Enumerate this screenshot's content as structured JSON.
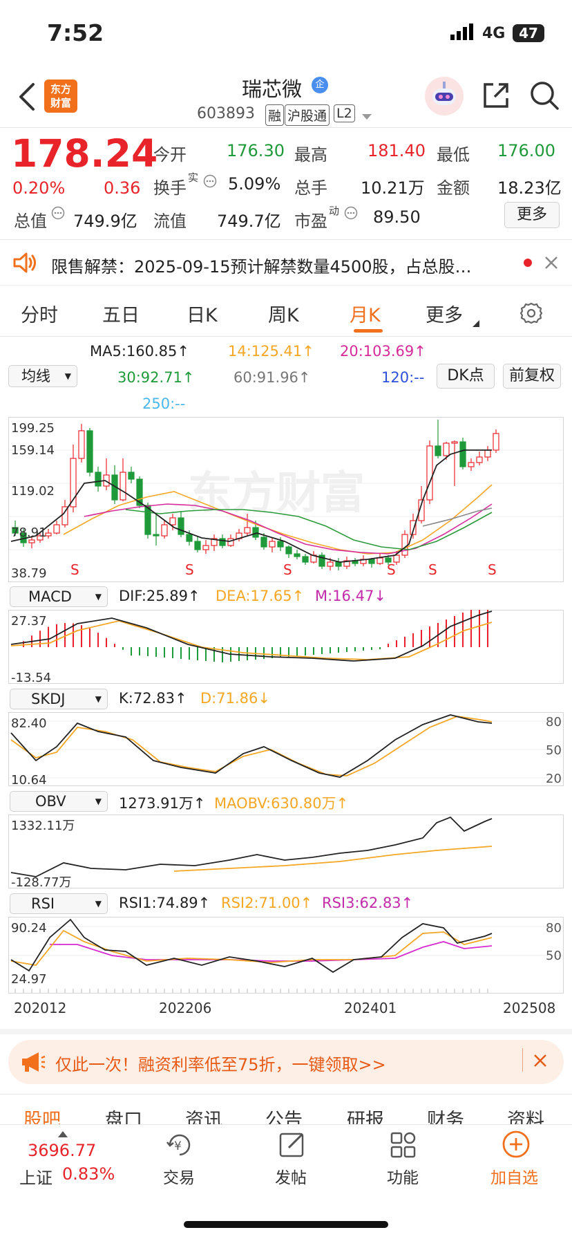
{
  "status_bar": {
    "time": "7:52",
    "network": "4G",
    "battery": "47"
  },
  "header": {
    "stock_name": "瑞芯微",
    "badge": "企",
    "code": "603893",
    "tags": [
      "融",
      "沪股通",
      "L2"
    ],
    "logo_lines": [
      "东方",
      "财富"
    ]
  },
  "quote": {
    "price": "178.24",
    "change_pct": "0.20%",
    "change_amt": "0.36",
    "open_label": "今开",
    "open": "176.30",
    "high_label": "最高",
    "high": "181.40",
    "low_label": "最低",
    "low": "176.00",
    "turnover_label": "换手",
    "turnover_sup": "实",
    "turnover": "5.09%",
    "volume_label": "总手",
    "volume": "10.21万",
    "amount_label": "金额",
    "amount": "18.23亿",
    "mktcap_label": "总值",
    "mktcap": "749.9亿",
    "float_label": "流值",
    "float": "749.7亿",
    "pe_label": "市盈",
    "pe_sup": "动",
    "pe": "89.50",
    "more_label": "更多"
  },
  "notice": {
    "text": "限售解禁：2025-09-15预计解禁数量4500股，占总股…"
  },
  "period_tabs": [
    {
      "label": "分时"
    },
    {
      "label": "五日"
    },
    {
      "label": "日K"
    },
    {
      "label": "周K"
    },
    {
      "label": "月K",
      "active": true
    },
    {
      "label": "更多"
    }
  ],
  "ma_legend": {
    "ma5": "MA5:160.85↑",
    "ma14": "14:125.41↑",
    "ma20": "20:103.69↑",
    "ma30": "30:92.71↑",
    "ma60": "60:91.96↑",
    "ma120": "120:--",
    "ma250": "250:--",
    "dropdown": "均线",
    "dk_button": "DK点",
    "adjust_button": "前复权"
  },
  "indicators": {
    "macd": {
      "name": "MACD",
      "dif": "DIF:25.89↑",
      "dea": "DEA:17.65↑",
      "m": "M:16.47↓",
      "axis_top": "27.37",
      "axis_bottom": "-13.54"
    },
    "skdj": {
      "name": "SKDJ",
      "k": "K:72.83↑",
      "d": "D:71.86↓",
      "axis_top": "82.40",
      "axis_bottom": "10.64",
      "levels": [
        "80",
        "50",
        "20"
      ]
    },
    "obv": {
      "name": "OBV",
      "obv": "1273.91万↑",
      "maobv": "MAOBV:630.80万↑",
      "axis_top": "1332.11万",
      "axis_bottom": "-128.77万"
    },
    "rsi": {
      "name": "RSI",
      "rsi1": "RSI1:74.89↑",
      "rsi2": "RSI2:71.00↑",
      "rsi3": "RSI3:62.83↑",
      "axis_top": "90.24",
      "axis_bottom": "24.97",
      "levels": [
        "80",
        "50"
      ]
    }
  },
  "chart_data": {
    "type": "candlestick",
    "period": "monthly",
    "y_ticks": [
      "199.25",
      "159.14",
      "119.02",
      "78.91",
      "38.79"
    ],
    "x_ticks": [
      "202012",
      "202206",
      "202401",
      "202508"
    ],
    "watermark": "东方财富",
    "signal_markers": [
      "S",
      "S",
      "S",
      "S",
      "S",
      "S"
    ],
    "series": [
      {
        "name": "MA5",
        "last": 160.85,
        "color": "#222222"
      },
      {
        "name": "MA14",
        "last": 125.41,
        "color": "#f5a623"
      },
      {
        "name": "MA20",
        "last": 103.69,
        "color": "#d62a9a"
      },
      {
        "name": "MA30",
        "last": 92.71,
        "color": "#2a9a3a"
      },
      {
        "name": "MA60",
        "last": 91.96,
        "color": "#888888"
      }
    ]
  },
  "promo": {
    "text": "仅此一次！融资利率低至75折，一键领取>>"
  },
  "bottom_tabs": [
    "股吧",
    "盘口",
    "资讯",
    "公告",
    "研报",
    "财务",
    "资料"
  ],
  "bottom_nav": {
    "index_value": "3696.77",
    "index_name": "上证",
    "index_change": "0.83%",
    "items": [
      {
        "label": "交易"
      },
      {
        "label": "发帖"
      },
      {
        "label": "功能"
      },
      {
        "label": "加自选"
      }
    ]
  },
  "colors": {
    "up": "#e8242a",
    "down": "#1f9a3a",
    "accent": "#f2701c"
  }
}
